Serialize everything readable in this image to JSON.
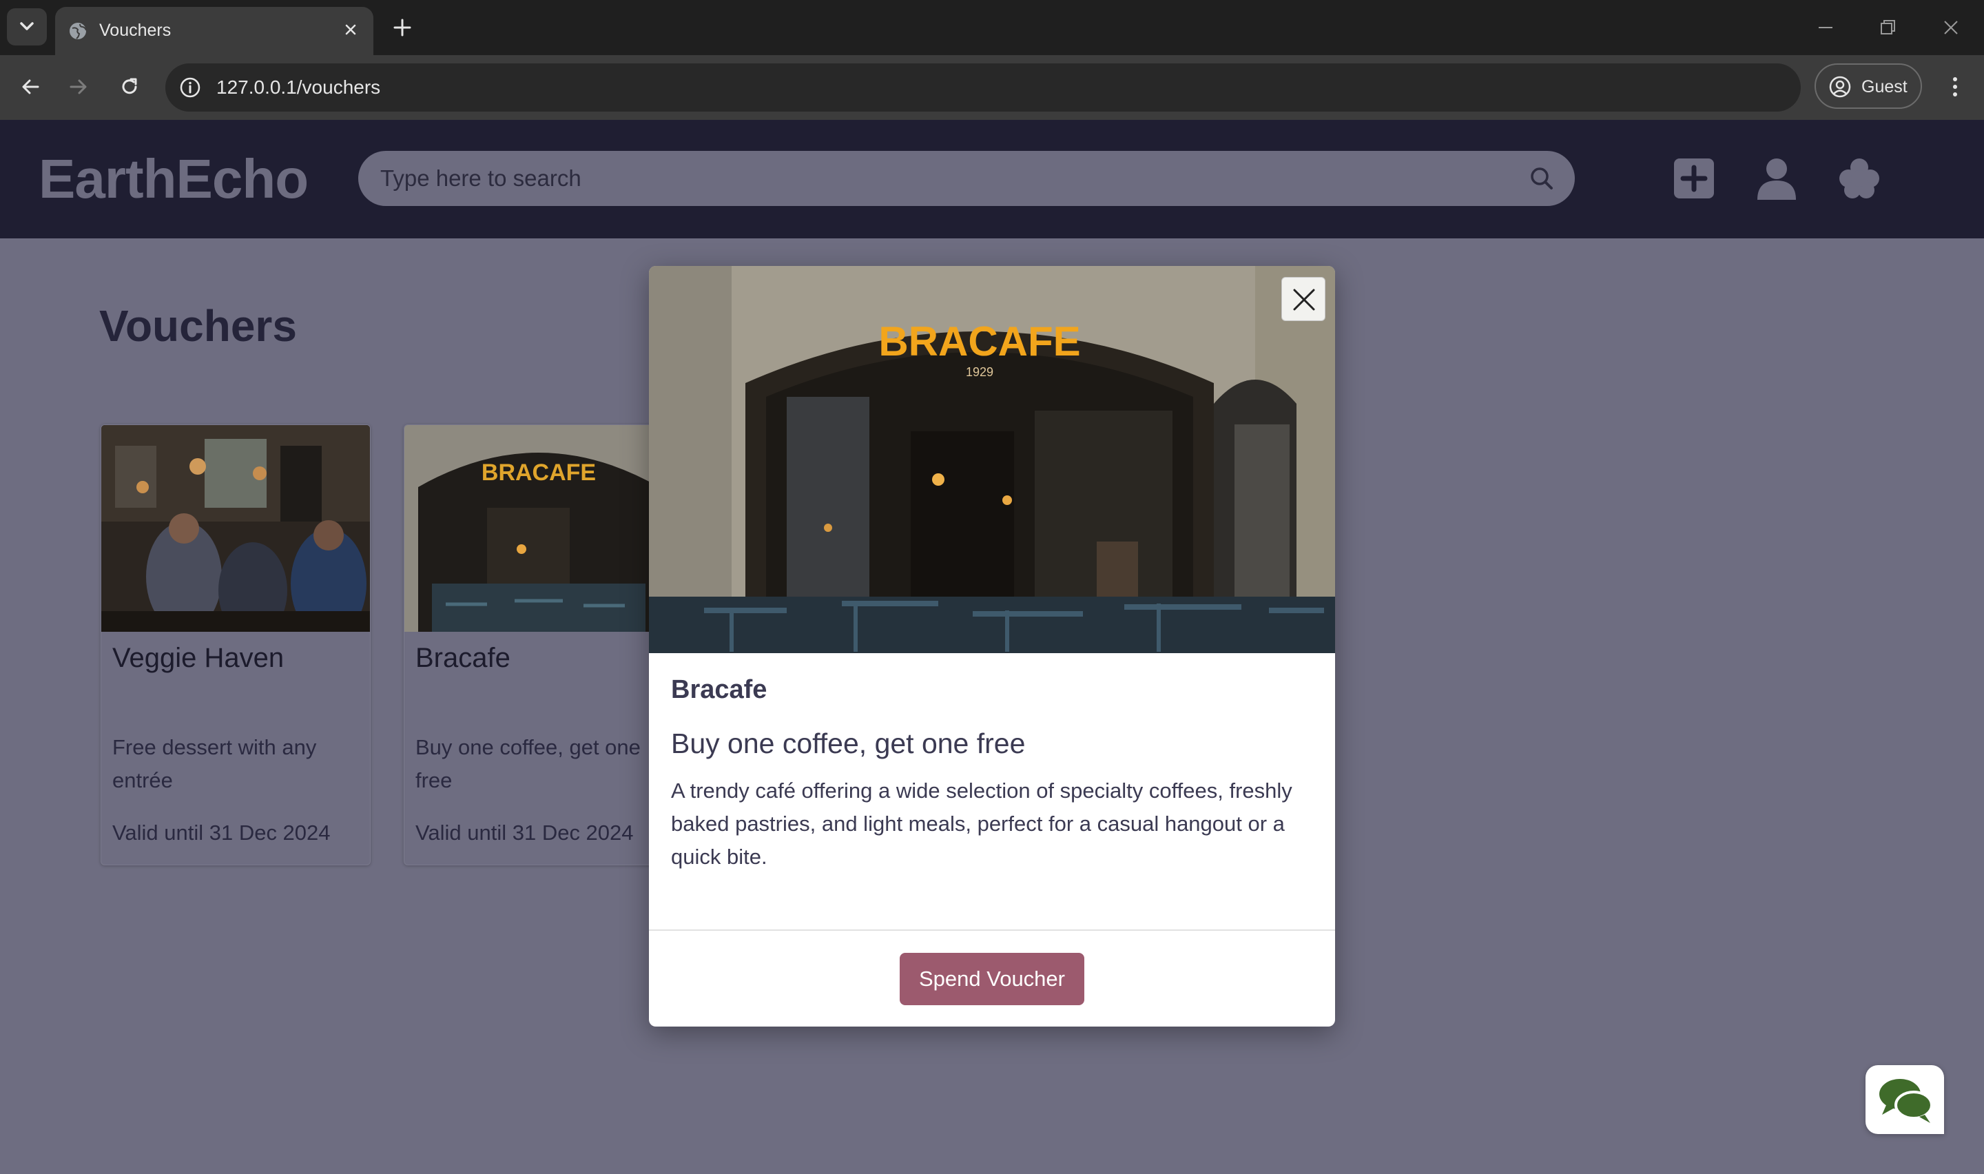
{
  "browser": {
    "tab_title": "Vouchers",
    "url": "127.0.0.1/vouchers",
    "profile_label": "Guest"
  },
  "app": {
    "brand": "EarthEcho",
    "search_placeholder": "Type here to search",
    "header_icons": [
      "plus-square-icon",
      "user-icon",
      "clover-icon"
    ]
  },
  "page": {
    "title": "Vouchers",
    "cards": [
      {
        "name": "Veggie Haven",
        "offer": "Free dessert with any entrée",
        "valid": "Valid until 31 Dec 2024"
      },
      {
        "name": "Bracafe",
        "offer": "Buy one coffee, get one free",
        "valid": "Valid until 31 Dec 2024"
      }
    ]
  },
  "modal": {
    "sign_text": "BRACAFE",
    "sign_year": "1929",
    "name": "Bracafe",
    "offer": "Buy one coffee, get one free",
    "description": "A trendy café offering a wide selection of specialty coffees, freshly baked pastries, and light meals, perfect for a casual hangout or a quick bite.",
    "button": "Spend Voucher"
  },
  "colors": {
    "header_bg": "#1f1e32",
    "overlay_bg": "#6e6d81",
    "accent_button": "#9c5a6e",
    "text_dark": "#3b3a52",
    "chat_icon": "#3f6b2a"
  }
}
